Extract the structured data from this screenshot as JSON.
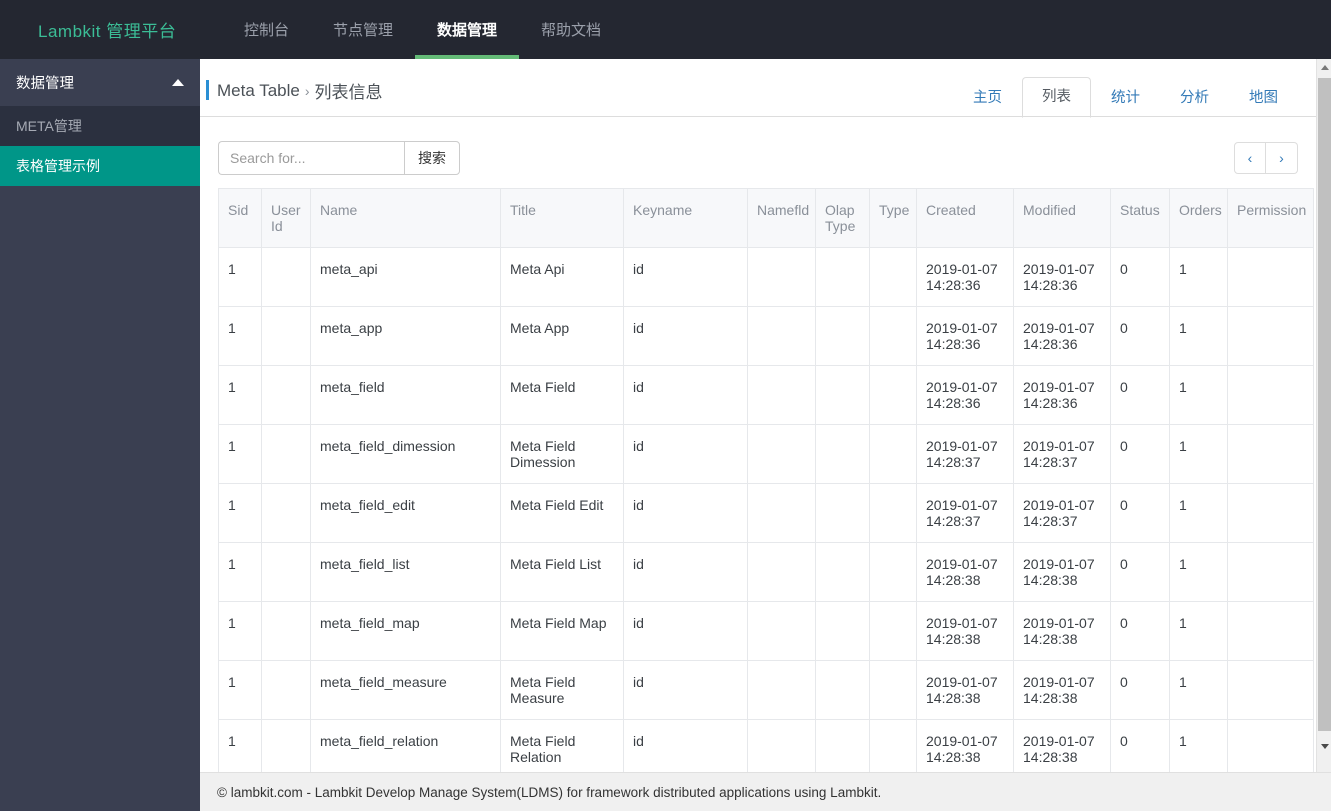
{
  "navbar": {
    "brand": "Lambkit 管理平台",
    "items": [
      {
        "label": "控制台"
      },
      {
        "label": "节点管理"
      },
      {
        "label": "数据管理"
      },
      {
        "label": "帮助文档"
      }
    ],
    "active_index": 2,
    "bg_color": "#242731",
    "brand_color": "#3bbd96",
    "active_underline_color": "#64bb77"
  },
  "sidebar": {
    "header": "数据管理",
    "collapse_icon": "caret-up-icon",
    "items": [
      {
        "label": "META管理",
        "active": false
      },
      {
        "label": "表格管理示例",
        "active": true
      }
    ],
    "bg_color": "#3a3f51",
    "active_color": "#009688"
  },
  "breadcrumb": {
    "part1": "Meta Table",
    "separator": "›",
    "part2": "列表信息",
    "accent_color": "#2a8fd4"
  },
  "tabs": [
    {
      "label": "主页",
      "active": false
    },
    {
      "label": "列表",
      "active": true
    },
    {
      "label": "统计",
      "active": false
    },
    {
      "label": "分析",
      "active": false
    },
    {
      "label": "地图",
      "active": false
    }
  ],
  "search": {
    "placeholder": "Search for...",
    "value": "",
    "button_label": "搜索"
  },
  "pager": {
    "prev": "‹",
    "next": "›"
  },
  "table": {
    "columns": [
      "Sid",
      "User Id",
      "Name",
      "Title",
      "Keyname",
      "Namefld",
      "Olap Type",
      "Type",
      "Created",
      "Modified",
      "Status",
      "Orders",
      "Permission"
    ],
    "rows": [
      {
        "sid": "1",
        "user_id": "",
        "name": "meta_api",
        "title": "Meta Api",
        "keyname": "id",
        "namefld": "",
        "olap_type": "",
        "type": "",
        "created": "2019-01-07 14:28:36",
        "modified": "2019-01-07 14:28:36",
        "status": "0",
        "orders": "1",
        "permission": ""
      },
      {
        "sid": "1",
        "user_id": "",
        "name": "meta_app",
        "title": "Meta App",
        "keyname": "id",
        "namefld": "",
        "olap_type": "",
        "type": "",
        "created": "2019-01-07 14:28:36",
        "modified": "2019-01-07 14:28:36",
        "status": "0",
        "orders": "1",
        "permission": ""
      },
      {
        "sid": "1",
        "user_id": "",
        "name": "meta_field",
        "title": "Meta Field",
        "keyname": "id",
        "namefld": "",
        "olap_type": "",
        "type": "",
        "created": "2019-01-07 14:28:36",
        "modified": "2019-01-07 14:28:36",
        "status": "0",
        "orders": "1",
        "permission": ""
      },
      {
        "sid": "1",
        "user_id": "",
        "name": "meta_field_dimession",
        "title": "Meta Field Dimession",
        "keyname": "id",
        "namefld": "",
        "olap_type": "",
        "type": "",
        "created": "2019-01-07 14:28:37",
        "modified": "2019-01-07 14:28:37",
        "status": "0",
        "orders": "1",
        "permission": ""
      },
      {
        "sid": "1",
        "user_id": "",
        "name": "meta_field_edit",
        "title": "Meta Field Edit",
        "keyname": "id",
        "namefld": "",
        "olap_type": "",
        "type": "",
        "created": "2019-01-07 14:28:37",
        "modified": "2019-01-07 14:28:37",
        "status": "0",
        "orders": "1",
        "permission": ""
      },
      {
        "sid": "1",
        "user_id": "",
        "name": "meta_field_list",
        "title": "Meta Field List",
        "keyname": "id",
        "namefld": "",
        "olap_type": "",
        "type": "",
        "created": "2019-01-07 14:28:38",
        "modified": "2019-01-07 14:28:38",
        "status": "0",
        "orders": "1",
        "permission": ""
      },
      {
        "sid": "1",
        "user_id": "",
        "name": "meta_field_map",
        "title": "Meta Field Map",
        "keyname": "id",
        "namefld": "",
        "olap_type": "",
        "type": "",
        "created": "2019-01-07 14:28:38",
        "modified": "2019-01-07 14:28:38",
        "status": "0",
        "orders": "1",
        "permission": ""
      },
      {
        "sid": "1",
        "user_id": "",
        "name": "meta_field_measure",
        "title": "Meta Field Measure",
        "keyname": "id",
        "namefld": "",
        "olap_type": "",
        "type": "",
        "created": "2019-01-07 14:28:38",
        "modified": "2019-01-07 14:28:38",
        "status": "0",
        "orders": "1",
        "permission": ""
      },
      {
        "sid": "1",
        "user_id": "",
        "name": "meta_field_relation",
        "title": "Meta Field Relation",
        "keyname": "id",
        "namefld": "",
        "olap_type": "",
        "type": "",
        "created": "2019-01-07 14:28:38",
        "modified": "2019-01-07 14:28:38",
        "status": "0",
        "orders": "1",
        "permission": ""
      }
    ]
  },
  "footer": {
    "text": "© lambkit.com - Lambkit Develop Manage System(LDMS) for framework distributed applications using Lambkit."
  }
}
